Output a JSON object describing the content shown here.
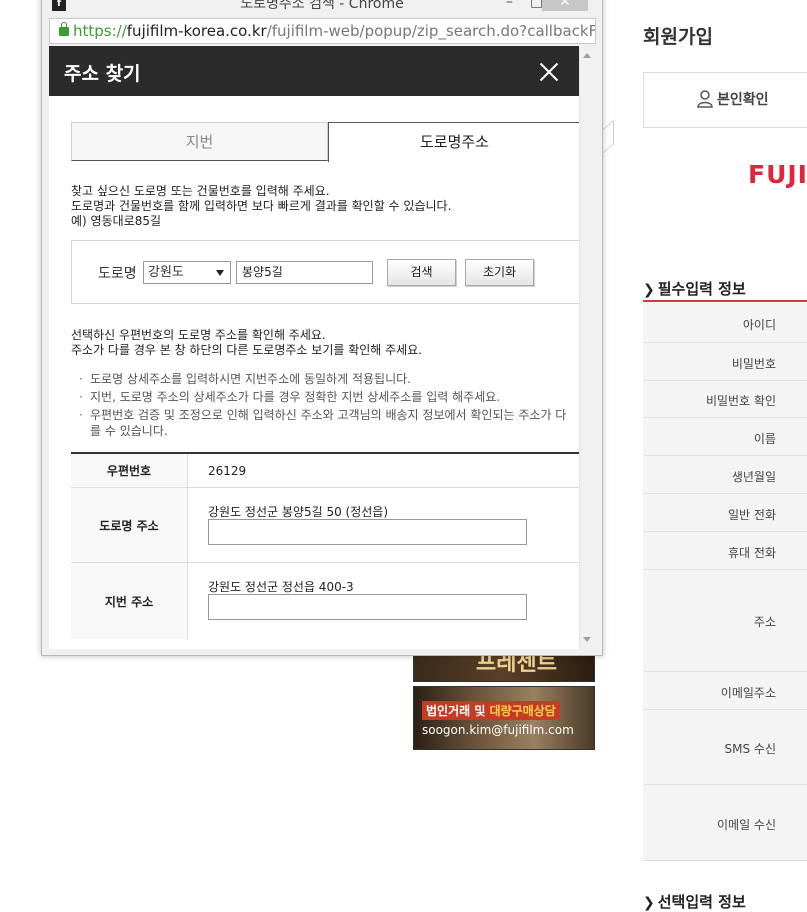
{
  "background": {
    "signup_title": "회원가입",
    "verify_label": "본인확인",
    "brand": "FUJI",
    "required_section": "필수입력 정보",
    "optional_section": "선택입력 정보",
    "form_rows": [
      "아이디",
      "비밀번호",
      "비밀번호 확인",
      "이름",
      "생년월일",
      "일반 전화",
      "휴대 전화",
      "주소",
      "이메일주소",
      "SMS 수신",
      "이메일 수신"
    ],
    "banner_top": "프레젠트",
    "banner_text_1": "법인거래 및",
    "banner_text_1_highlight": "대량구매상담",
    "banner_text_2": "soogon.kim@fujifilm.com"
  },
  "window": {
    "title": "도로명주소 검색 - Chrome",
    "url_scheme": "https://",
    "url_host": "fujifilm-korea.co.kr",
    "url_path": "/fujifilm-web/popup/zip_search.do?callbackFu"
  },
  "popup": {
    "title": "주소 찾기",
    "tabs": {
      "lot": "지번",
      "road": "도로명주소"
    },
    "guide_lines": [
      "찾고 싶으신 도로명 또는 건물번호를 입력해 주세요.",
      "도로명과 건물번호를 함께 입력하면 보다 빠르게 결과를 확인할 수 있습니다.",
      "예) 영동대로85길"
    ],
    "search": {
      "label": "도로명",
      "province": "강원도",
      "road_value": "봉양5길",
      "search_button": "검색",
      "reset_button": "초기화"
    },
    "confirm_lines": [
      "선택하신 우편번호의 도로명 주소를 확인해 주세요.",
      "주소가 다를 경우 본 창 하단의 다른 도로명주소 보기를 확인해 주세요."
    ],
    "notes": [
      "도로명 상세주소를 입력하시면 지번주소에 동일하게 적용됩니다.",
      "지번, 도로명 주소의 상세주소가 다를 경우 정확한 지번 상세주소를 입력 해주세요.",
      "우편번호 검증 및 조정으로 인해 입력하신 주소와 고객님의 배송지 정보에서 확인되는 주소가 다를 수 있습니다."
    ],
    "result": {
      "zip_label": "우편번호",
      "zip_value": "26129",
      "road_label": "도로명 주소",
      "road_value": "강원도 정선군 봉양5길 50 (정선읍)",
      "lot_label": "지번 주소",
      "lot_value": "강원도 정선군 정선읍 400-3"
    }
  }
}
